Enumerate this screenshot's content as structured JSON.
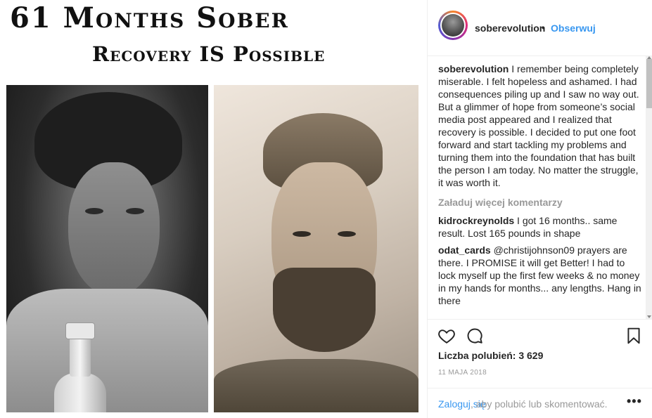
{
  "image": {
    "headline": "61 Months Sober",
    "subline": "Recovery IS Possible"
  },
  "header": {
    "username": "soberevolution",
    "separator": "•",
    "follow_label": "Obserwuj"
  },
  "caption": {
    "username": "soberevolution",
    "text": "I remember being completely miserable. I felt hopeless and ashamed. I had consequences piling up and I saw no way out. But a glimmer of hope from someone’s social media post appeared and I realized that recovery is possible. I decided to put one foot forward and start tackling my problems and turning them into the foundation that has built the person I am today. No matter the struggle, it was worth it."
  },
  "load_more_label": "Załaduj więcej komentarzy",
  "comments": [
    {
      "username": "kidrockreynolds",
      "text": "I got 16 months.. same result. Lost 165 pounds in shape"
    },
    {
      "username": "odat_cards",
      "text": "@christijohnson09 prayers are there. I PROMISE it will get Better! I had to lock myself up the first few weeks & no money in my hands for months... any lengths. Hang in there"
    }
  ],
  "likes_label": "Liczba polubień: 3 629",
  "date_label": "11 MAJA 2018",
  "login": {
    "link": "Zaloguj się",
    "text": ", aby polubić lub skomentować.",
    "more": "•••"
  },
  "colors": {
    "link_blue": "#3897f0",
    "text_dark": "#262626",
    "text_muted": "#999999"
  },
  "icons": [
    "heart-icon",
    "comment-icon",
    "bookmark-icon",
    "more-options-icon"
  ]
}
